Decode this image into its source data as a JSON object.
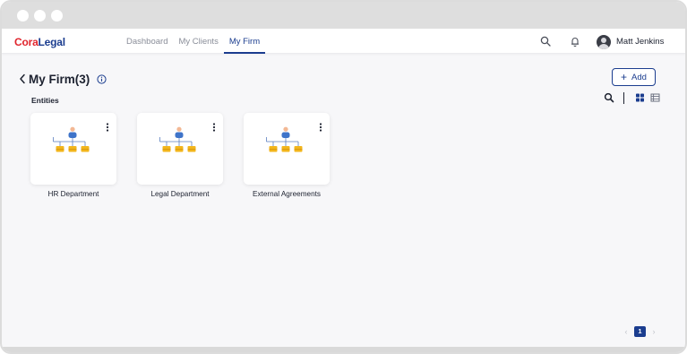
{
  "app": {
    "logo_part1": "Cora",
    "logo_part2": "Legal"
  },
  "nav": {
    "tabs": [
      {
        "label": "Dashboard"
      },
      {
        "label": "My Clients"
      },
      {
        "label": "My Firm",
        "active": true
      }
    ]
  },
  "header": {
    "user_name": "Matt Jenkins",
    "icons": [
      "search-icon",
      "bell-icon",
      "user-avatar"
    ]
  },
  "page": {
    "title": "My Firm(3)",
    "add_label": "Add",
    "section_label": "Entities",
    "view_icons": [
      "search-icon",
      "grid-view-icon",
      "list-view-icon"
    ]
  },
  "entities": [
    {
      "name": "HR Department"
    },
    {
      "name": "Legal Department"
    },
    {
      "name": "External Agreements"
    }
  ],
  "pagination": {
    "current_page": "1"
  },
  "colors": {
    "accent": "#1b3d8f",
    "logo_red": "#e0252d",
    "org_blue": "#3f74c9",
    "org_gold": "#f2b51c"
  }
}
